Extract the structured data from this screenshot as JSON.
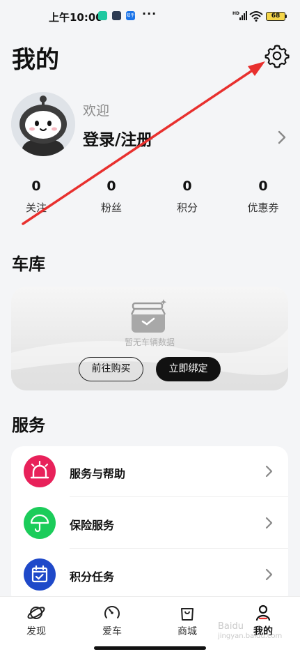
{
  "status_bar": {
    "time": "上午10:00",
    "apps": [
      {
        "icon": "wechat-icon",
        "color": "#1fc8a0",
        "glyph": "◆"
      },
      {
        "icon": "app-icon",
        "color": "#2d3b52",
        "glyph": "■"
      },
      {
        "icon": "zhihu-icon",
        "color": "#1a73e8",
        "glyph": "知乎"
      }
    ],
    "more": "···",
    "network": "HD",
    "battery": "68"
  },
  "header": {
    "title": "我的",
    "settings_icon": "gear-icon"
  },
  "profile": {
    "welcome": "欢迎",
    "login_label": "登录/注册",
    "avatar_icon": "avatar-robot-icon"
  },
  "stats": [
    {
      "value": "0",
      "label": "关注"
    },
    {
      "value": "0",
      "label": "粉丝"
    },
    {
      "value": "0",
      "label": "积分"
    },
    {
      "value": "0",
      "label": "优惠券"
    }
  ],
  "garage": {
    "title": "车库",
    "empty_text": "暂无车辆数据",
    "buy_label": "前往购买",
    "bind_label": "立即绑定"
  },
  "services": {
    "title": "服务",
    "items": [
      {
        "label": "服务与帮助",
        "icon": "siren-icon",
        "color": "#e8215a"
      },
      {
        "label": "保险服务",
        "icon": "umbrella-icon",
        "color": "#1bcc5a"
      },
      {
        "label": "积分任务",
        "icon": "calendar-check-icon",
        "color": "#1f49c9"
      }
    ]
  },
  "bottom_nav": {
    "items": [
      {
        "label": "发现",
        "icon": "planet-icon"
      },
      {
        "label": "爱车",
        "icon": "steering-icon"
      },
      {
        "label": "商城",
        "icon": "shopping-bag-icon"
      },
      {
        "label": "我的",
        "icon": "person-icon"
      }
    ],
    "active": "我的"
  },
  "watermark": {
    "line1": "Baidu",
    "line2": "jingyan.baidu.com"
  },
  "colors": {
    "background": "#f4f5f7",
    "annotation_arrow": "#e8302e",
    "bind_button": "#111111"
  }
}
